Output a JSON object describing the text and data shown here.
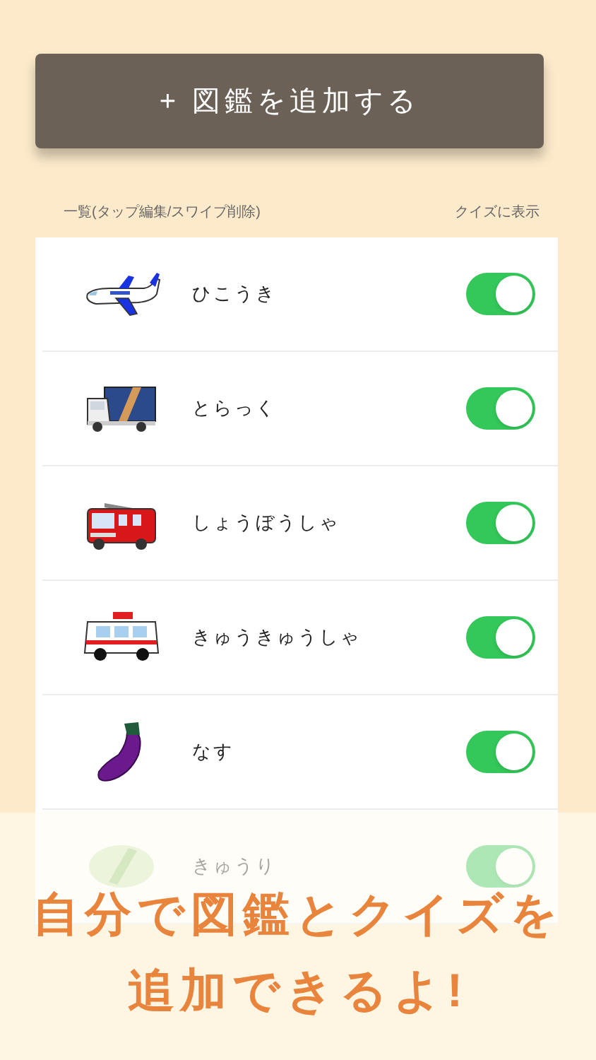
{
  "add_button": {
    "label": "+ 図鑑を追加する"
  },
  "list_header": {
    "left": "一覧(タップ編集/スワイプ削除)",
    "right": "クイズに表示"
  },
  "items": [
    {
      "name": "ひこうき",
      "on": true
    },
    {
      "name": "とらっく",
      "on": true
    },
    {
      "name": "しょうぼうしゃ",
      "on": true
    },
    {
      "name": "きゅうきゅうしゃ",
      "on": true
    },
    {
      "name": "なす",
      "on": true
    },
    {
      "name": "きゅうり",
      "on": true
    }
  ],
  "caption": {
    "lines": [
      "自分で図鑑とクイズを",
      "追加できるよ!"
    ]
  }
}
